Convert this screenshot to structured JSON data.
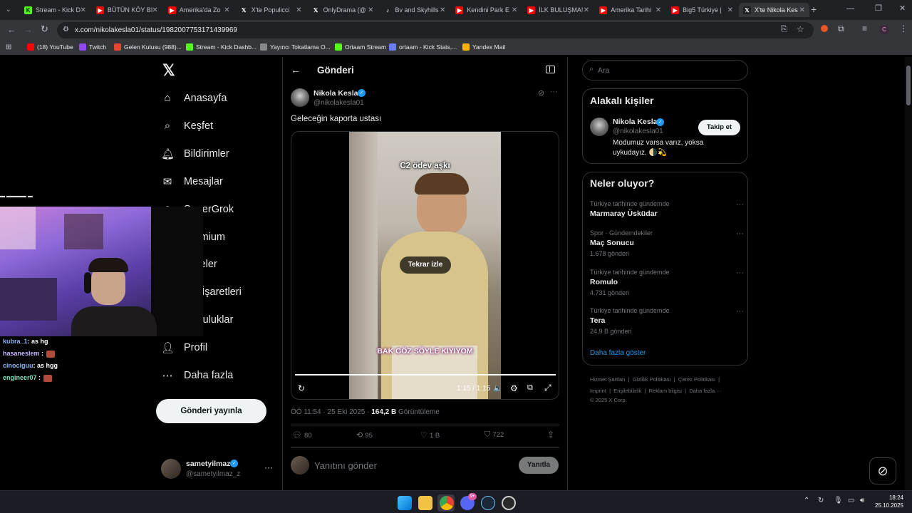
{
  "browser": {
    "tabs": [
      {
        "title": "Stream - Kick D",
        "icon": "kick-icon",
        "color": "#53fc18"
      },
      {
        "title": "BÜTÜN KÖY BI",
        "icon": "youtube-icon",
        "color": "#ff0000"
      },
      {
        "title": "Amerika'da Zo",
        "icon": "youtube-icon",
        "color": "#ff0000"
      },
      {
        "title": "X'te Populicci",
        "icon": "x-icon",
        "color": "#202124"
      },
      {
        "title": "OnlyDrama (@",
        "icon": "x-icon",
        "color": "#202124"
      },
      {
        "title": "Bv and Skyhills",
        "icon": "tiktok-icon",
        "color": "#202124"
      },
      {
        "title": "Kendini Park E",
        "icon": "youtube-icon",
        "color": "#ff0000"
      },
      {
        "title": "İLK BULUŞMA!",
        "icon": "youtube-icon",
        "color": "#ff0000"
      },
      {
        "title": "Amerika Tarihi",
        "icon": "youtube-icon",
        "color": "#ff0000"
      },
      {
        "title": "Big5 Türkiye |",
        "icon": "youtube-icon",
        "color": "#ff0000"
      },
      {
        "title": "X'te Nikola Kes",
        "icon": "x-icon",
        "color": "#202124"
      }
    ],
    "url": "x.com/nikolakesla01/status/1982007753171439969",
    "bookmarks": [
      {
        "label": "(18) YouTube",
        "icon": "youtube-icon",
        "color": "#ff0000"
      },
      {
        "label": "Twitch",
        "icon": "twitch-icon",
        "color": "#9146ff"
      },
      {
        "label": "Gelen Kutusu (988)...",
        "icon": "gmail-icon",
        "color": "#ea4335"
      },
      {
        "label": "Stream - Kick Dashb...",
        "icon": "kick-icon",
        "color": "#53fc18"
      },
      {
        "label": "Yayıncı Tokatlama O...",
        "icon": "globe-icon",
        "color": "#888888"
      },
      {
        "label": "Ortaam Stream",
        "icon": "kick-icon",
        "color": "#53fc18"
      },
      {
        "label": "ortaam - Kick Stats,...",
        "icon": "stats-icon",
        "color": "#6a7cff"
      },
      {
        "label": "Yandex Mail",
        "icon": "mail-icon",
        "color": "#ffb300"
      }
    ],
    "profile_letter": "C"
  },
  "nav": {
    "items": [
      {
        "label": "Anasayfa",
        "icon": "home-icon"
      },
      {
        "label": "Keşfet",
        "icon": "search-icon"
      },
      {
        "label": "Bildirimler",
        "icon": "bell-icon"
      },
      {
        "label": "Mesajlar",
        "icon": "mail-icon"
      },
      {
        "label": "SuperGrok",
        "icon": "grok-icon"
      },
      {
        "label": "Premium",
        "icon": "x-icon"
      },
      {
        "label": "Listeler",
        "icon": "list-icon"
      },
      {
        "label": "Yer İşaretleri",
        "icon": "bookmark-icon"
      },
      {
        "label": "Topluluklar",
        "icon": "people-icon"
      },
      {
        "label": "Profil",
        "icon": "person-icon"
      },
      {
        "label": "Daha fazla",
        "icon": "more-icon"
      }
    ],
    "post_button": "Gönderi yayınla",
    "account": {
      "name": "sametyilmaz",
      "handle": "@sametyilmaz_z"
    }
  },
  "post": {
    "header_title": "Gönderi",
    "author_name": "Nikola Kesla",
    "author_handle": "@nikolakesla01",
    "text": "Geleceğin kaporta ustası",
    "video": {
      "caption_top": "C2 ödev aşkı",
      "caption_bottom": "BAK GÖZ SÖYLE KIYIYOM",
      "replay_label": "Tekrar izle",
      "time": "1:15 / 1:15",
      "progress": 1.0
    },
    "meta_time": "ÖÖ 11:54 · 25 Eki 2025 · ",
    "views_count": "164,2 B",
    "views_label": " Görüntüleme",
    "stats": {
      "replies": "80",
      "reposts": "95",
      "likes": "1 B",
      "bookmarks": "722"
    },
    "reply_placeholder": "Yanıtını gönder",
    "reply_button": "Yanıtla"
  },
  "sidebar": {
    "search_placeholder": "Ara",
    "related_title": "Alakalı kişiler",
    "related": {
      "name": "Nikola Kesla",
      "handle": "@nikolakesla01",
      "bio": "Modumuz varsa varız, yoksa uykudayız. 🌗💫",
      "follow": "Takip et"
    },
    "trends_title": "Neler oluyor?",
    "trends": [
      {
        "category": "Türkiye tarihinde gündemde",
        "name": "Marmaray Üsküdar",
        "count": ""
      },
      {
        "category": "Spor · Gündemdekiler",
        "name": "Maç Sonucu",
        "count": "1.678 gönderi"
      },
      {
        "category": "Türkiye tarihinde gündemde",
        "name": "Romulo",
        "count": "4.731 gönderi"
      },
      {
        "category": "Türkiye tarihinde gündemde",
        "name": "Tera",
        "count": "24,9 B gönderi"
      }
    ],
    "show_more": "Daha fazla göster",
    "footer_line1": "Hizmet Şartları  |  Gizlilik Politikası  |  Çerez Politikası  |",
    "footer_line2": "Imprint  |  Erişilebilirlik  |  Reklam bilgisi  |  Daha fazla ···",
    "footer_line3": "© 2025 X Corp."
  },
  "stream_overlay": {
    "chat": [
      {
        "user": "kubra_1",
        "msg": ": as hg",
        "color": "#8ab4f8"
      },
      {
        "user": "hasaneslem",
        "msg": " :",
        "color": "#c8b6ff"
      },
      {
        "user": "cinociguu",
        "msg": ": as hgg",
        "color": "#8ab4f8"
      },
      {
        "user": "engineer07",
        "msg": " :",
        "color": "#7fe3c0"
      }
    ]
  },
  "taskbar": {
    "time": "18:24",
    "date": "25.10.2025",
    "badge": "9+"
  },
  "colors": {
    "accent": "#1d9bf0",
    "bg": "#000000",
    "border": "#2f3336"
  }
}
